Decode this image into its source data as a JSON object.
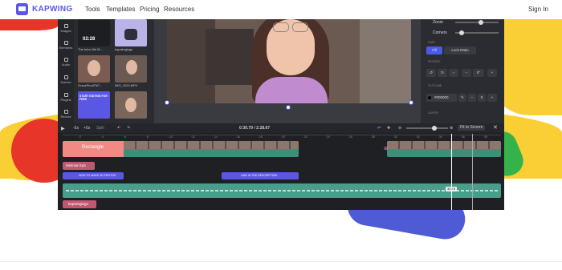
{
  "nav": {
    "brand": "KAPWING",
    "links": [
      "Tools",
      "Templates",
      "Pricing",
      "Resources"
    ],
    "signin": "Sign In"
  },
  "editor": {
    "sidebar": [
      "Images",
      "Elements",
      "Audio",
      "Scenes",
      "Plugins",
      "Record"
    ],
    "media": [
      {
        "caption": "The Intro We M..."
      },
      {
        "caption": "kapwinglogo"
      },
      {
        "caption": "GraceFinalTikT..."
      },
      {
        "caption": "IMG_1023.MP4"
      },
      {
        "caption": ""
      },
      {
        "caption": ""
      }
    ],
    "thumb_time": "02:28",
    "thumb_promo": "START EDITING FOR FREE",
    "panel": {
      "zoom": "Zoom",
      "corners": "Corners",
      "size": "SIZE",
      "fill": "Fill",
      "lock_ratio": "Lock Ratio",
      "rotate": "ROTATE",
      "outline": "OUTLINE",
      "outline_color": "#000000",
      "outline_width": "0",
      "layer": "LAYER",
      "zoom_level": 0.6,
      "corners_level": 0.1
    },
    "timeline": {
      "skip_back": "-5s",
      "skip_fwd": "+5s",
      "split": "Split",
      "time": "0:30.79 / 2:28.67",
      "fit": "Fit to Screen",
      "ruler": [
        ":2",
        ":4",
        ":6",
        ":8",
        ":10",
        ":12",
        ":14",
        ":16",
        ":18",
        ":20",
        ":22",
        ":24",
        ":26",
        ":28",
        ":30",
        ":32",
        ":34",
        ":36",
        ":38"
      ],
      "rectangle": "Rectangle",
      "minimal": "Minimal Sub",
      "text1": "HOW TO MAKE 3D PHOTOS",
      "text2": "LINK IN THE DESCRIPTION",
      "logo_track": "kapwinglogo",
      "playhead_time": "30.79"
    }
  },
  "colors": {
    "brand": "#5b57e5",
    "yellow": "#f9cf35",
    "red": "#e8352a",
    "green": "#36b24b",
    "blue": "#4f5bd5"
  }
}
